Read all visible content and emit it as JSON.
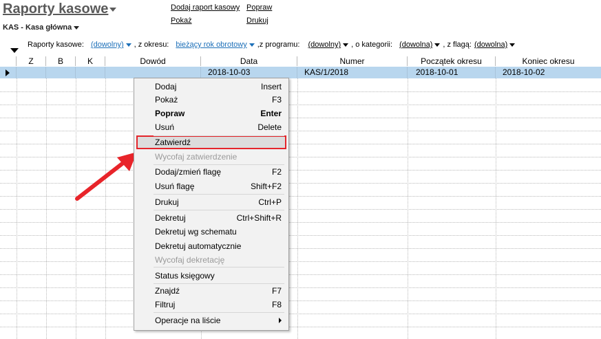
{
  "header": {
    "title": "Raporty kasowe",
    "subtitle": "KAS - Kasa główna",
    "links": {
      "add_report": "Dodaj raport kasowy",
      "correct": "Popraw",
      "show": "Pokaż",
      "print": "Drukuj"
    }
  },
  "filters": {
    "label_reports": "Raporty kasowe:",
    "reports_value": "(dowolny)",
    "label_period": ", z okresu:",
    "period_value": "bieżący rok obrotowy",
    "label_program": ",z programu:",
    "program_value": "(dowolny)",
    "label_category": ", o kategorii:",
    "category_value": "(dowolna)",
    "label_flag": ", z flagą:",
    "flag_value": "(dowolna)"
  },
  "table": {
    "columns": [
      "Z",
      "B",
      "K",
      "Dowód",
      "Data",
      "Numer",
      "Początek okresu",
      "Koniec okresu"
    ],
    "rows": [
      {
        "z": "",
        "b": "",
        "k": "",
        "dowod": "",
        "data": "2018-10-03",
        "numer": "KAS/1/2018",
        "poczatek": "2018-10-01",
        "koniec": "2018-10-02"
      }
    ]
  },
  "context_menu": {
    "items": [
      {
        "label": "Dodaj",
        "shortcut": "Insert"
      },
      {
        "label": "Pokaż",
        "shortcut": "F3"
      },
      {
        "label": "Popraw",
        "shortcut": "Enter"
      },
      {
        "label": "Usuń",
        "shortcut": "Delete"
      },
      {
        "label": "Zatwierdź",
        "shortcut": ""
      },
      {
        "label": "Wycofaj zatwierdzenie",
        "shortcut": ""
      },
      {
        "label": "Dodaj/zmień flagę",
        "shortcut": "F2"
      },
      {
        "label": "Usuń flagę",
        "shortcut": "Shift+F2"
      },
      {
        "label": "Drukuj",
        "shortcut": "Ctrl+P"
      },
      {
        "label": "Dekretuj",
        "shortcut": "Ctrl+Shift+R"
      },
      {
        "label": "Dekretuj wg schematu",
        "shortcut": ""
      },
      {
        "label": "Dekretuj automatycznie",
        "shortcut": ""
      },
      {
        "label": "Wycofaj dekretację",
        "shortcut": ""
      },
      {
        "label": "Status księgowy",
        "shortcut": ""
      },
      {
        "label": "Znajdź",
        "shortcut": "F7"
      },
      {
        "label": "Filtruj",
        "shortcut": "F8"
      },
      {
        "label": "Operacje na liście",
        "shortcut": ""
      }
    ]
  },
  "colors": {
    "selection_row": "#b8d6ee",
    "link_blue": "#1c6fb8",
    "highlight_border": "#e4242a",
    "annotation_arrow": "#e8242a"
  },
  "icons": {
    "title_dropdown": "chevron-down-icon",
    "row_pointer": "triangle-right-icon",
    "submenu": "chevron-right-icon"
  }
}
